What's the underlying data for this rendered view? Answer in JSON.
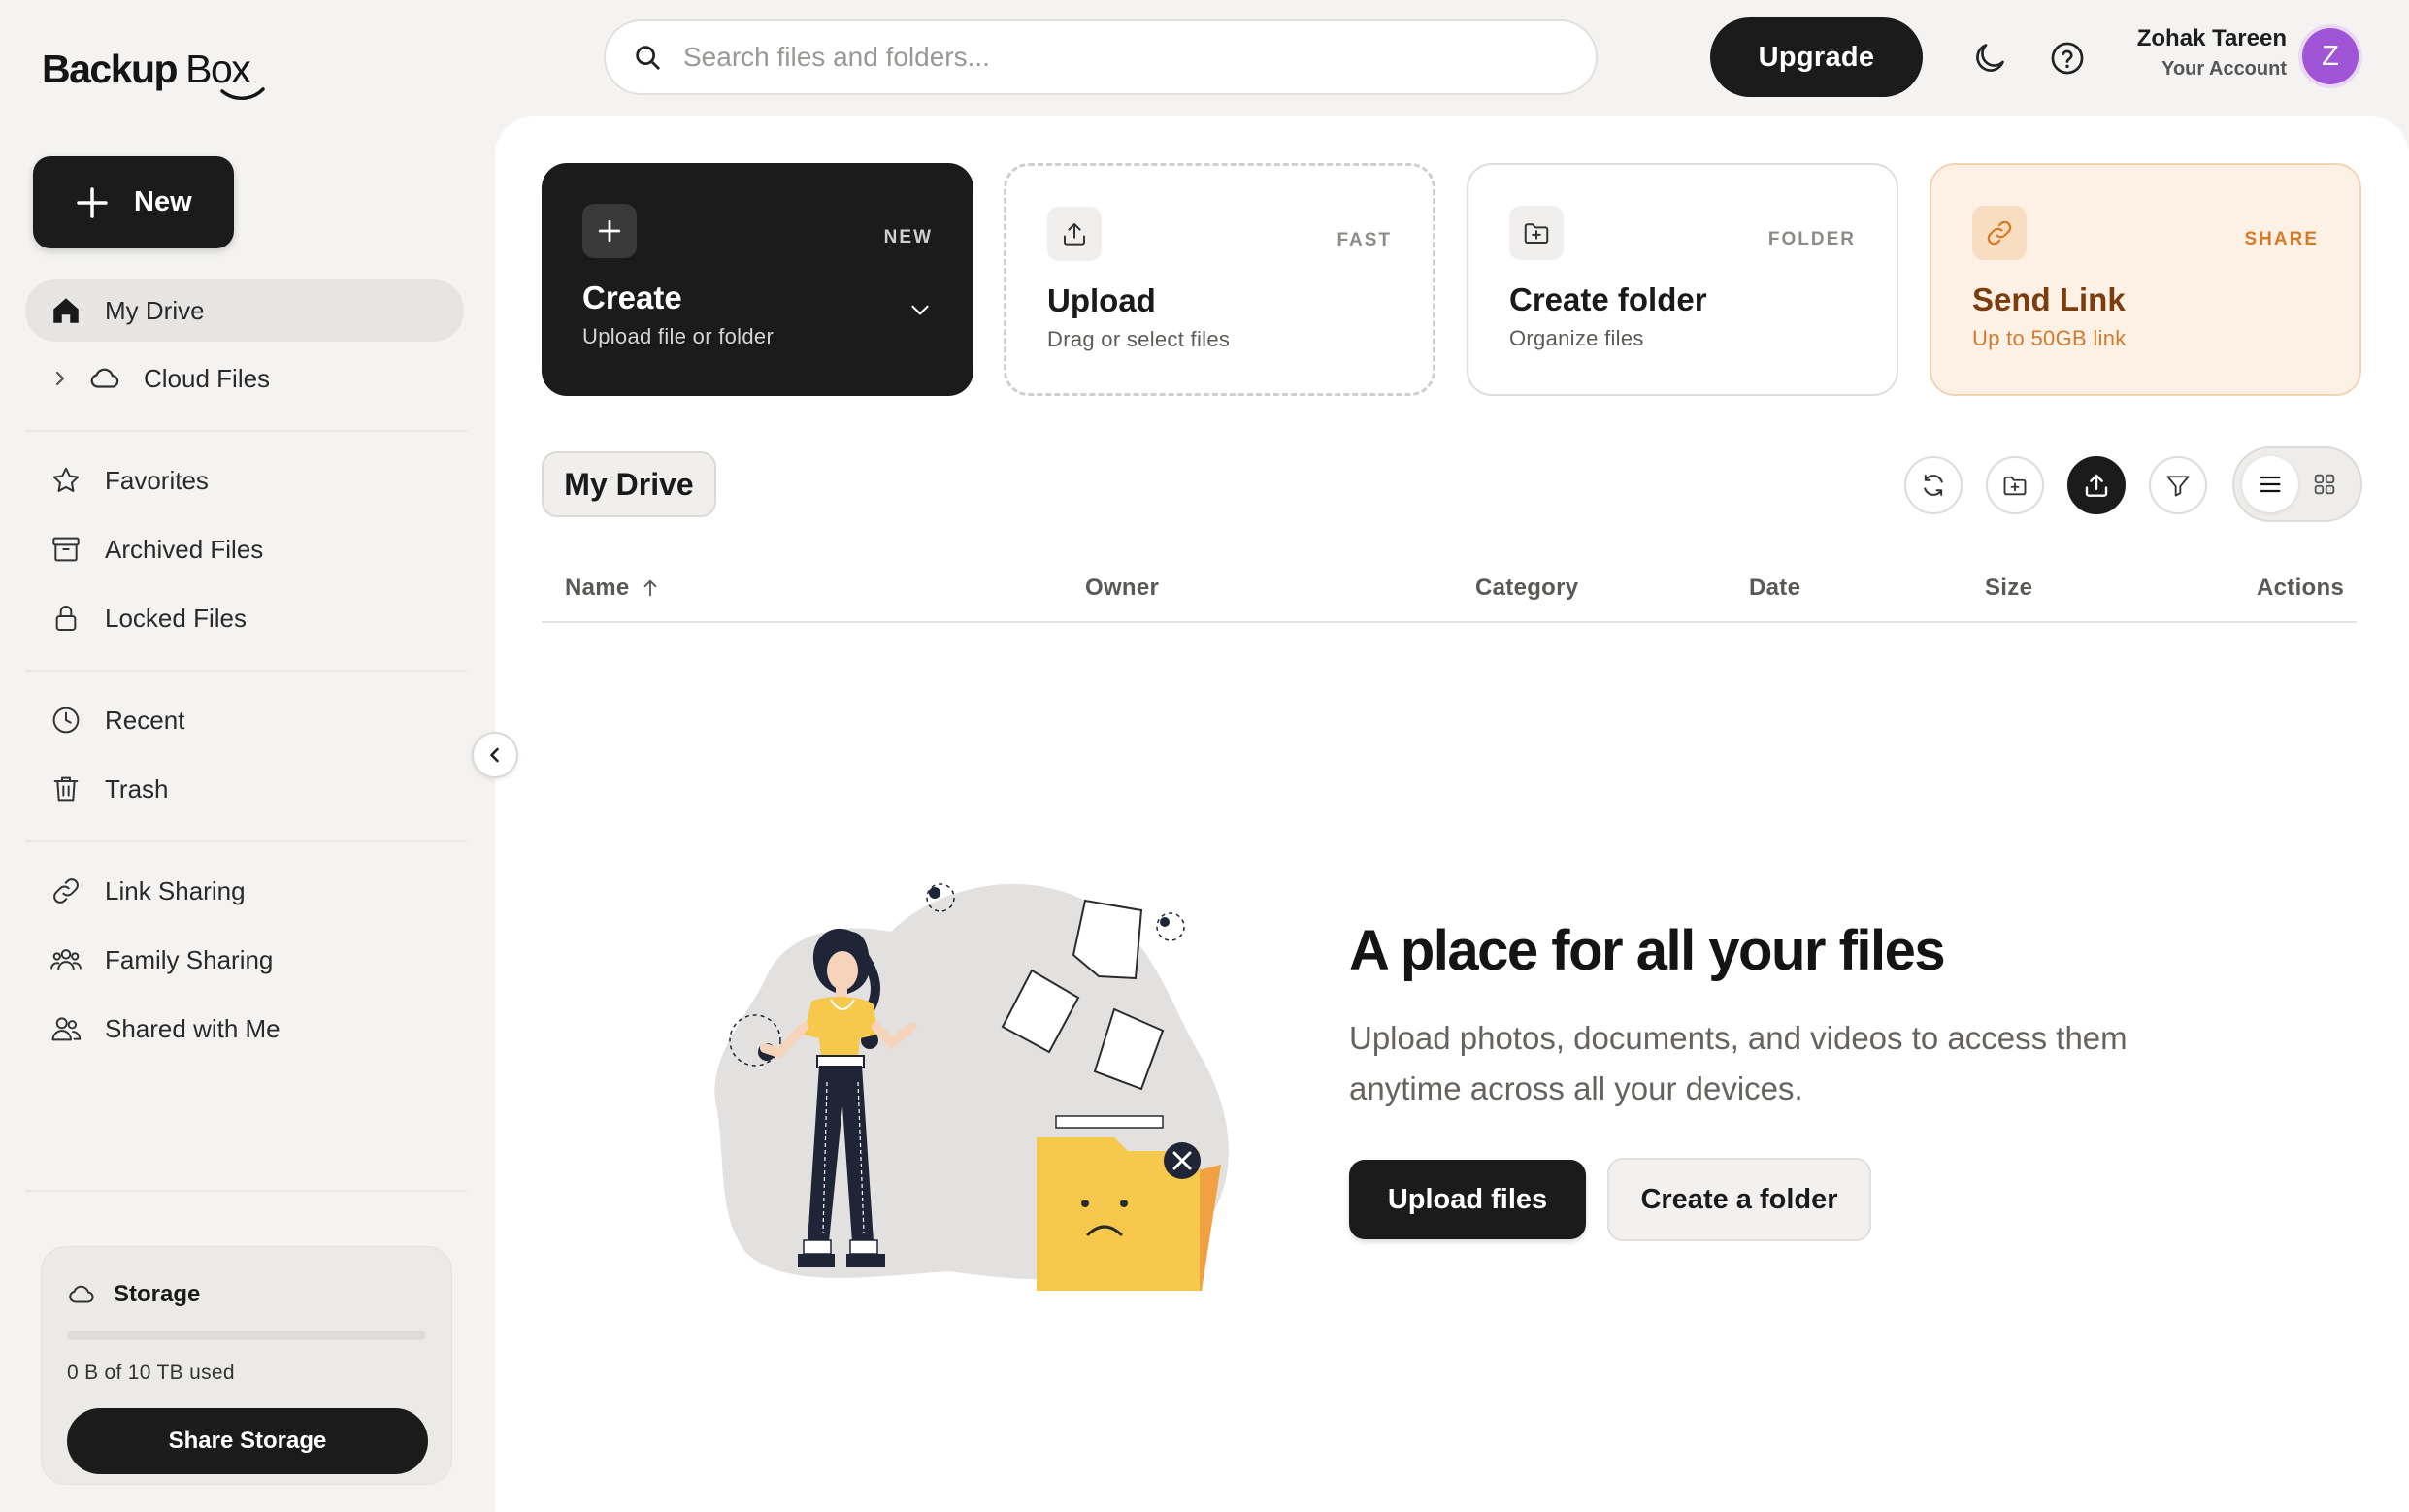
{
  "app": {
    "logo_bold": "Backup",
    "logo_light": "Box"
  },
  "sidebar": {
    "new_label": "New",
    "items": [
      {
        "label": "My Drive",
        "icon": "home-icon",
        "active": true
      },
      {
        "label": "Cloud Files",
        "icon": "cloud-icon"
      },
      {
        "label": "Favorites",
        "icon": "star-icon"
      },
      {
        "label": "Archived Files",
        "icon": "archive-icon"
      },
      {
        "label": "Locked Files",
        "icon": "lock-icon"
      },
      {
        "label": "Recent",
        "icon": "clock-icon"
      },
      {
        "label": "Trash",
        "icon": "trash-icon"
      },
      {
        "label": "Link Sharing",
        "icon": "link-icon"
      },
      {
        "label": "Family Sharing",
        "icon": "family-icon"
      },
      {
        "label": "Shared with Me",
        "icon": "users-icon"
      }
    ],
    "storage": {
      "title": "Storage",
      "used_text": "0 B of 10 TB used",
      "used_fraction": 0,
      "share_label": "Share Storage"
    }
  },
  "header": {
    "search_placeholder": "Search files and folders...",
    "upgrade_label": "Upgrade",
    "user_name": "Zohak Tareen",
    "user_sub": "Your Account",
    "avatar_initial": "Z",
    "avatar_color": "#a055d6"
  },
  "cards": [
    {
      "title": "Create",
      "desc": "Upload file or folder",
      "tag": "NEW",
      "icon": "plus-icon"
    },
    {
      "title": "Upload",
      "desc": "Drag or select files",
      "tag": "FAST",
      "icon": "upload-icon"
    },
    {
      "title": "Create folder",
      "desc": "Organize files",
      "tag": "FOLDER",
      "icon": "folder-plus-icon"
    },
    {
      "title": "Send Link",
      "desc": "Up to 50GB link",
      "tag": "SHARE",
      "icon": "link-icon",
      "accent": "#d77a26"
    }
  ],
  "drive": {
    "title": "My Drive",
    "columns": [
      "Name",
      "Owner",
      "Category",
      "Date",
      "Size",
      "Actions"
    ],
    "sort_column": "Name",
    "view_mode": "list"
  },
  "empty_state": {
    "title": "A place for all your files",
    "desc": "Upload photos, documents, and videos to access them anytime across all your devices.",
    "upload_label": "Upload files",
    "folder_label": "Create a folder"
  }
}
